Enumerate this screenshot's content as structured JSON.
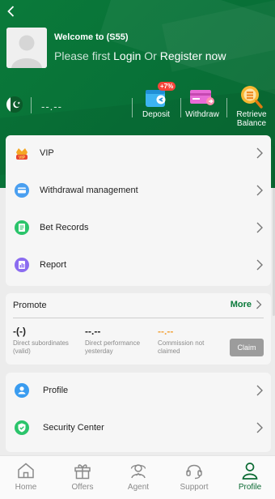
{
  "header": {
    "welcome": "Welcome to (S55)",
    "prompt_prefix": "Please first",
    "login_label": "Login",
    "or_label": "Or",
    "register_label": "Register now",
    "balance": "--.--",
    "actions": {
      "deposit_label": "Deposit",
      "deposit_badge": "+7%",
      "withdraw_label": "Withdraw",
      "retrieve_label_1": "Retrieve",
      "retrieve_label_2": "Balance"
    }
  },
  "menu_top": [
    {
      "label": "VIP",
      "icon": "vip-crown-icon"
    },
    {
      "label": "Withdrawal management",
      "icon": "wallet-icon"
    },
    {
      "label": "Bet Records",
      "icon": "document-icon"
    },
    {
      "label": "Report",
      "icon": "report-chart-icon"
    }
  ],
  "promote": {
    "title": "Promote",
    "more_label": "More",
    "stats": [
      {
        "value": "-(-)",
        "label_1": "Direct subordinates",
        "label_2": "(valid)"
      },
      {
        "value": "--.--",
        "label_1": "Direct performance",
        "label_2": "yesterday"
      },
      {
        "value": "--.--",
        "label_1": "Commission not",
        "label_2": "claimed"
      }
    ],
    "claim_label": "Claim"
  },
  "menu_bottom": [
    {
      "label": "Profile",
      "icon": "user-icon"
    },
    {
      "label": "Security Center",
      "icon": "shield-check-icon"
    }
  ],
  "tabs": [
    {
      "label": "Home",
      "icon": "home-icon"
    },
    {
      "label": "Offers",
      "icon": "gift-icon"
    },
    {
      "label": "Agent",
      "icon": "agent-icon"
    },
    {
      "label": "Support",
      "icon": "headset-icon"
    },
    {
      "label": "Profile",
      "icon": "person-icon",
      "active": true
    }
  ],
  "colors": {
    "brand_green": "#0a7a3a",
    "commission_orange": "#f2a33a",
    "badge_red": "#f5453a",
    "claim_gray": "#9c9c9c"
  }
}
